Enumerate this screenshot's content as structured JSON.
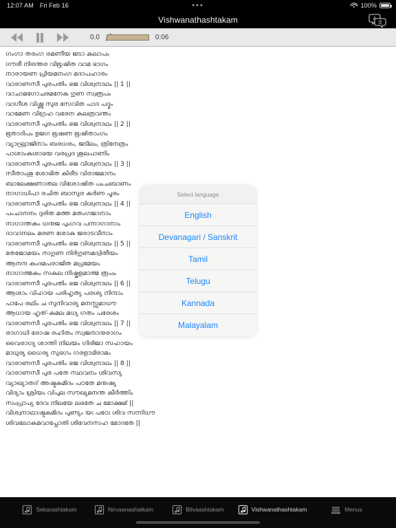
{
  "status_bar": {
    "time": "12:07 AM",
    "date": "Fri Feb 16",
    "center_dots": "•••",
    "battery_percent": "100%",
    "wifi_icon": "wifi-icon",
    "battery_icon": "battery-icon"
  },
  "nav": {
    "title": "Vishwanathashtakam",
    "translate_icon": "translate-icon"
  },
  "toolbar": {
    "rewind_icon": "rewind-icon",
    "pause_icon": "pause-icon",
    "forward_icon": "fast-forward-icon",
    "rate": "0.0",
    "elapsed": "0:06",
    "slider_icon": "volume-slider-handle-icon"
  },
  "language_picker": {
    "header": "Select language",
    "options": [
      "English",
      "Devanagari / Sanskrit",
      "Tamil",
      "Telugu",
      "Kannada",
      "Malayalam"
    ],
    "accent_color": "#1a84ff",
    "background_color": "#f1f1ef"
  },
  "lyrics": {
    "language": "Malayalam",
    "lines": [
      "ഗംഗാ തരംഗ രമണീയ ജടാ കലാപം",
      "ഗൗരീ നിരന്തര വിഭൂഷിത വാമ ഭാഗം",
      "നാരായണ പ്രിയമനംഗ മദാപഹാരം",
      "വാരാണസീ പുരപതിം ഭജ വിശ്വനാഥം || 1 ||",
      "വാചാമഗോചരമനേക ഗുണ സ്വരൂപം",
      "വാഗീശ വിഷ്ണു സുര സേവിത പാദ പദ്മം",
      "വാമേണ വിഗ്രഹ വരേന കലത്രവന്തം",
      "വാരാണസീ പുരപതിം ഭജ വിശ്വനാഥം || 2 ||",
      "ഭൂതാദിപം ഭുജഗ ഭൂഷണ ഭൂഷിതാംഗം",
      "വ്യാഘ്രാജിനാം ബരധരം, ജടിലം, ത്രിനേത്രം",
      "പാശാംകുശാഭയ വരപ്രദ ശൂലപാണിം",
      "വാരാണസീ പുരപതിം ഭജ വിശ്വനാഥം || 3 ||",
      "സീതാംശു ശോഭിത കിരീട വിരാജമാനം",
      "ബാലേക്ഷണാതല വിശോഷിത പംചബാണം",
      "നാഗാധിപാ രചിത ബാസുര കർണ പൂരം",
      "വാരാണസീ പുരപതിം ഭജ വിശ്വനാഥം || 4 ||",
      "പംചാനനം ദുരിത മത്ത മതംഗജാനാം",
      "നാഗാന്തകം ധനുജ പുംഗവ പന്നാഗാനാം",
      "ദാവാനലം മരണ ശോക ജരാടവീനാം",
      "വാരാണസീ പുരപതിം ഭജ വിശ്വനാഥം || 5 ||",
      "തേജോമയം സഗുണ നിർഗുണമദ്വിതീയം",
      "ആനന്ദ കംദമപരാജിത മപ്രമേയം",
      "നാഗാത്മകം സകല നിഷ്കളമാത്മ രൂപം",
      "വാരാണസീ പുരപതിം ഭജ വിശ്വനാഥം || 6 ||",
      "ആശാം വിഹായ പരിഹൃത്യ പരശ്യ നിന്ദാം",
      "പാപേ രഥിം ച സുനിവാര്യ മനസ്സമാധൗ",
      "ആധായ ഹൃത്-കമല മധ്യ ഗതം പരേശം",
      "വാരാണസീ പുരപതിം ഭജ വിശ്വനാഥം || 7 ||",
      "രാഗാധി രോഷ രഹിതം സ്വജനാനുരാഗം",
      "വൈരാഗ്യ ശാന്തി നിലയം ഗിരിജാ സഹായം",
      "മാധുര്യ ധൈര്യ സുഭഗം ഗരളാഭിരാമം",
      "വാരാണസീ പുരപതിം ഭജ വിശ്വനാഥം || 8 ||",
      "വാരാണസീ പുര പതേ സ്ഥവനം ശിവസ്യ",
      "വ്യാഖ്യാതദ് അഷ്ടകമിദം പഠതേ മനുഷ്യ",
      "വിദ്യാം ശ്രിയം വിപുല സൗഖ്യമനന്ത കീർത്തിം",
      "സംപ്രാപ്യ ദേവ നിലയേ ലഭതേ ച മോക്ഷമ് ||",
      "വിശ്വനാഥാഷ്ടകമിദം പുണ്യം യഃ പഠേഃ ശിവ സന്നിധൗ",
      "ശിവലോകമവാപ്നോതി ശിവേനസഹ മോദതേ ||"
    ]
  },
  "tab_bar": {
    "items": [
      {
        "label": "Sekarashtakam",
        "icon": "music-note-icon",
        "active": false
      },
      {
        "label": "Nirvaanashatkam",
        "icon": "music-note-icon",
        "active": false
      },
      {
        "label": "Bilvaashtakam",
        "icon": "music-note-icon",
        "active": false
      },
      {
        "label": "Vishwanathashtakam",
        "icon": "music-note-icon",
        "active": true
      },
      {
        "label": "Menus",
        "icon": "menus-icon",
        "active": false
      }
    ]
  }
}
